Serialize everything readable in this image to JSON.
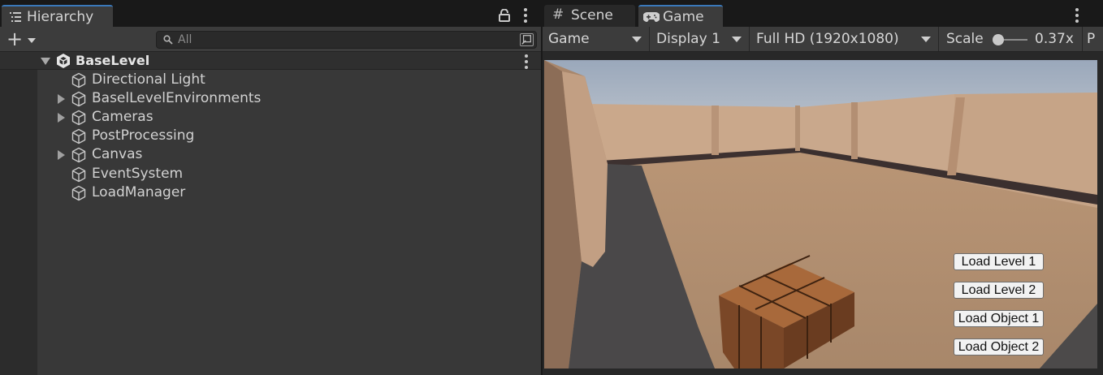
{
  "hierarchy": {
    "tab_label": "Hierarchy",
    "search_placeholder": "All",
    "scene_name": "BaseLevel",
    "objects": [
      {
        "label": "Directional Light",
        "expandable": false
      },
      {
        "label": "BaselLevelEnvironments",
        "expandable": true
      },
      {
        "label": "Cameras",
        "expandable": true
      },
      {
        "label": "PostProcessing",
        "expandable": false
      },
      {
        "label": "Canvas",
        "expandable": true
      },
      {
        "label": "EventSystem",
        "expandable": false
      },
      {
        "label": "LoadManager",
        "expandable": false
      }
    ]
  },
  "game_panel": {
    "tabs": [
      {
        "label": "Scene",
        "icon": "hash-icon",
        "active": false
      },
      {
        "label": "Game",
        "icon": "gamepad-icon",
        "active": true
      }
    ],
    "toolbar": {
      "view_mode": "Game",
      "display": "Display 1",
      "resolution": "Full HD (1920x1080)",
      "scale_label": "Scale",
      "scale_value": "0.37x",
      "scale_fraction": 0.37,
      "play_focus": "P"
    },
    "scene_buttons": [
      {
        "label": "Load Level 1"
      },
      {
        "label": "Load Level 2"
      },
      {
        "label": "Load Object 1"
      },
      {
        "label": "Load Object 2"
      }
    ]
  },
  "colors": {
    "accent": "#3a79bb",
    "panel_bg": "#383838",
    "toolbar_bg": "#3c3c3c",
    "sky": "#a6b2c2",
    "floor": "#b08e70",
    "wall": "#c7a589",
    "crate": "#8a5530"
  }
}
